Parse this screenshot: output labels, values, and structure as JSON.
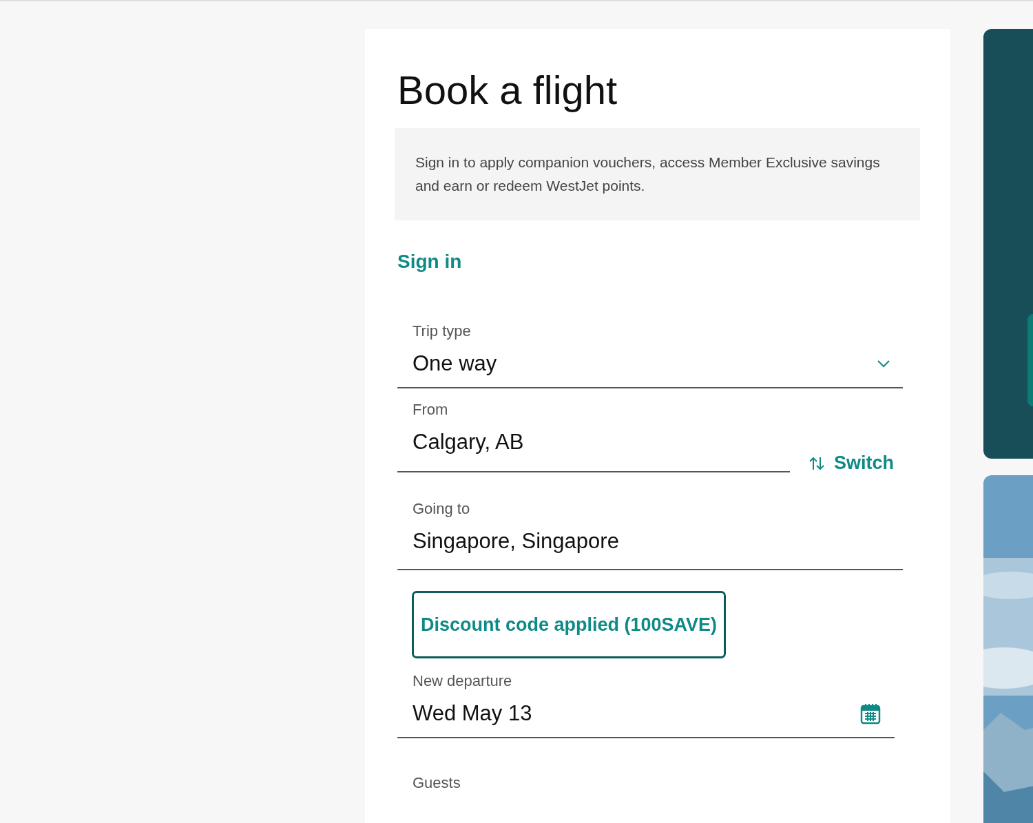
{
  "title": "Book a flight",
  "notice": "Sign in to apply companion vouchers, access Member Exclusive savings and earn or redeem WestJet points.",
  "sign_in_link": "Sign in",
  "fields": [
    {
      "kind": "select",
      "label": "Trip type",
      "value": "One way"
    },
    {
      "kind": "swap",
      "label": "From",
      "value": "Calgary, AB",
      "action": "Switch"
    },
    {
      "kind": "text",
      "label": "Going to",
      "value": "Singapore, Singapore"
    },
    {
      "kind": "button",
      "label": "Discount code applied (100SAVE)"
    },
    {
      "kind": "date",
      "label": "New departure",
      "value": "Wed May 13"
    },
    {
      "kind": "label",
      "label": "Guests"
    }
  ],
  "side_cards": [
    {
      "kind": "promo"
    },
    {
      "kind": "picture"
    }
  ]
}
